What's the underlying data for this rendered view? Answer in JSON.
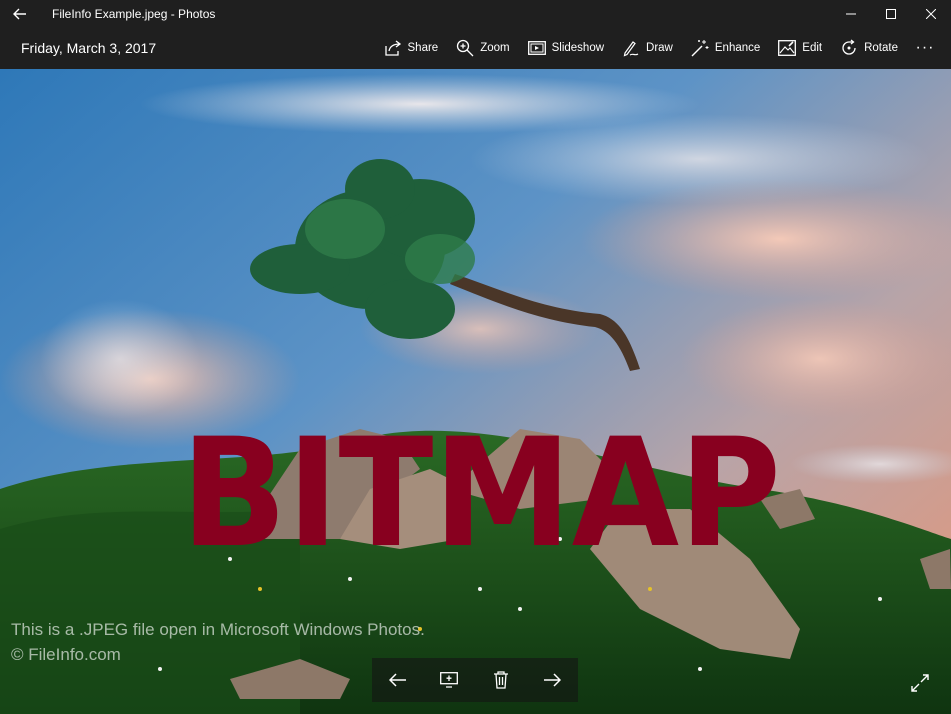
{
  "window": {
    "title": "FileInfo Example.jpeg - Photos"
  },
  "toolbar": {
    "date": "Friday, March 3, 2017",
    "actions": [
      {
        "label": "Share",
        "icon": "share-icon"
      },
      {
        "label": "Zoom",
        "icon": "zoom-icon"
      },
      {
        "label": "Slideshow",
        "icon": "slideshow-icon"
      },
      {
        "label": "Draw",
        "icon": "draw-icon"
      },
      {
        "label": "Enhance",
        "icon": "enhance-icon"
      },
      {
        "label": "Edit",
        "icon": "edit-icon"
      },
      {
        "label": "Rotate",
        "icon": "rotate-icon"
      }
    ],
    "more": "···"
  },
  "photo": {
    "overlay_text": "BITMAP",
    "caption_line1": "This is a .JPEG file open in Microsoft Windows Photos.",
    "caption_line2": "© FileInfo.com"
  },
  "bottom_nav": {
    "icons": [
      "arrow-left-icon",
      "add-to-album-icon",
      "delete-icon",
      "arrow-right-icon",
      "fullscreen-icon"
    ]
  },
  "colors": {
    "chrome": "#1f1f1f",
    "overlay_text": "#88001f"
  }
}
